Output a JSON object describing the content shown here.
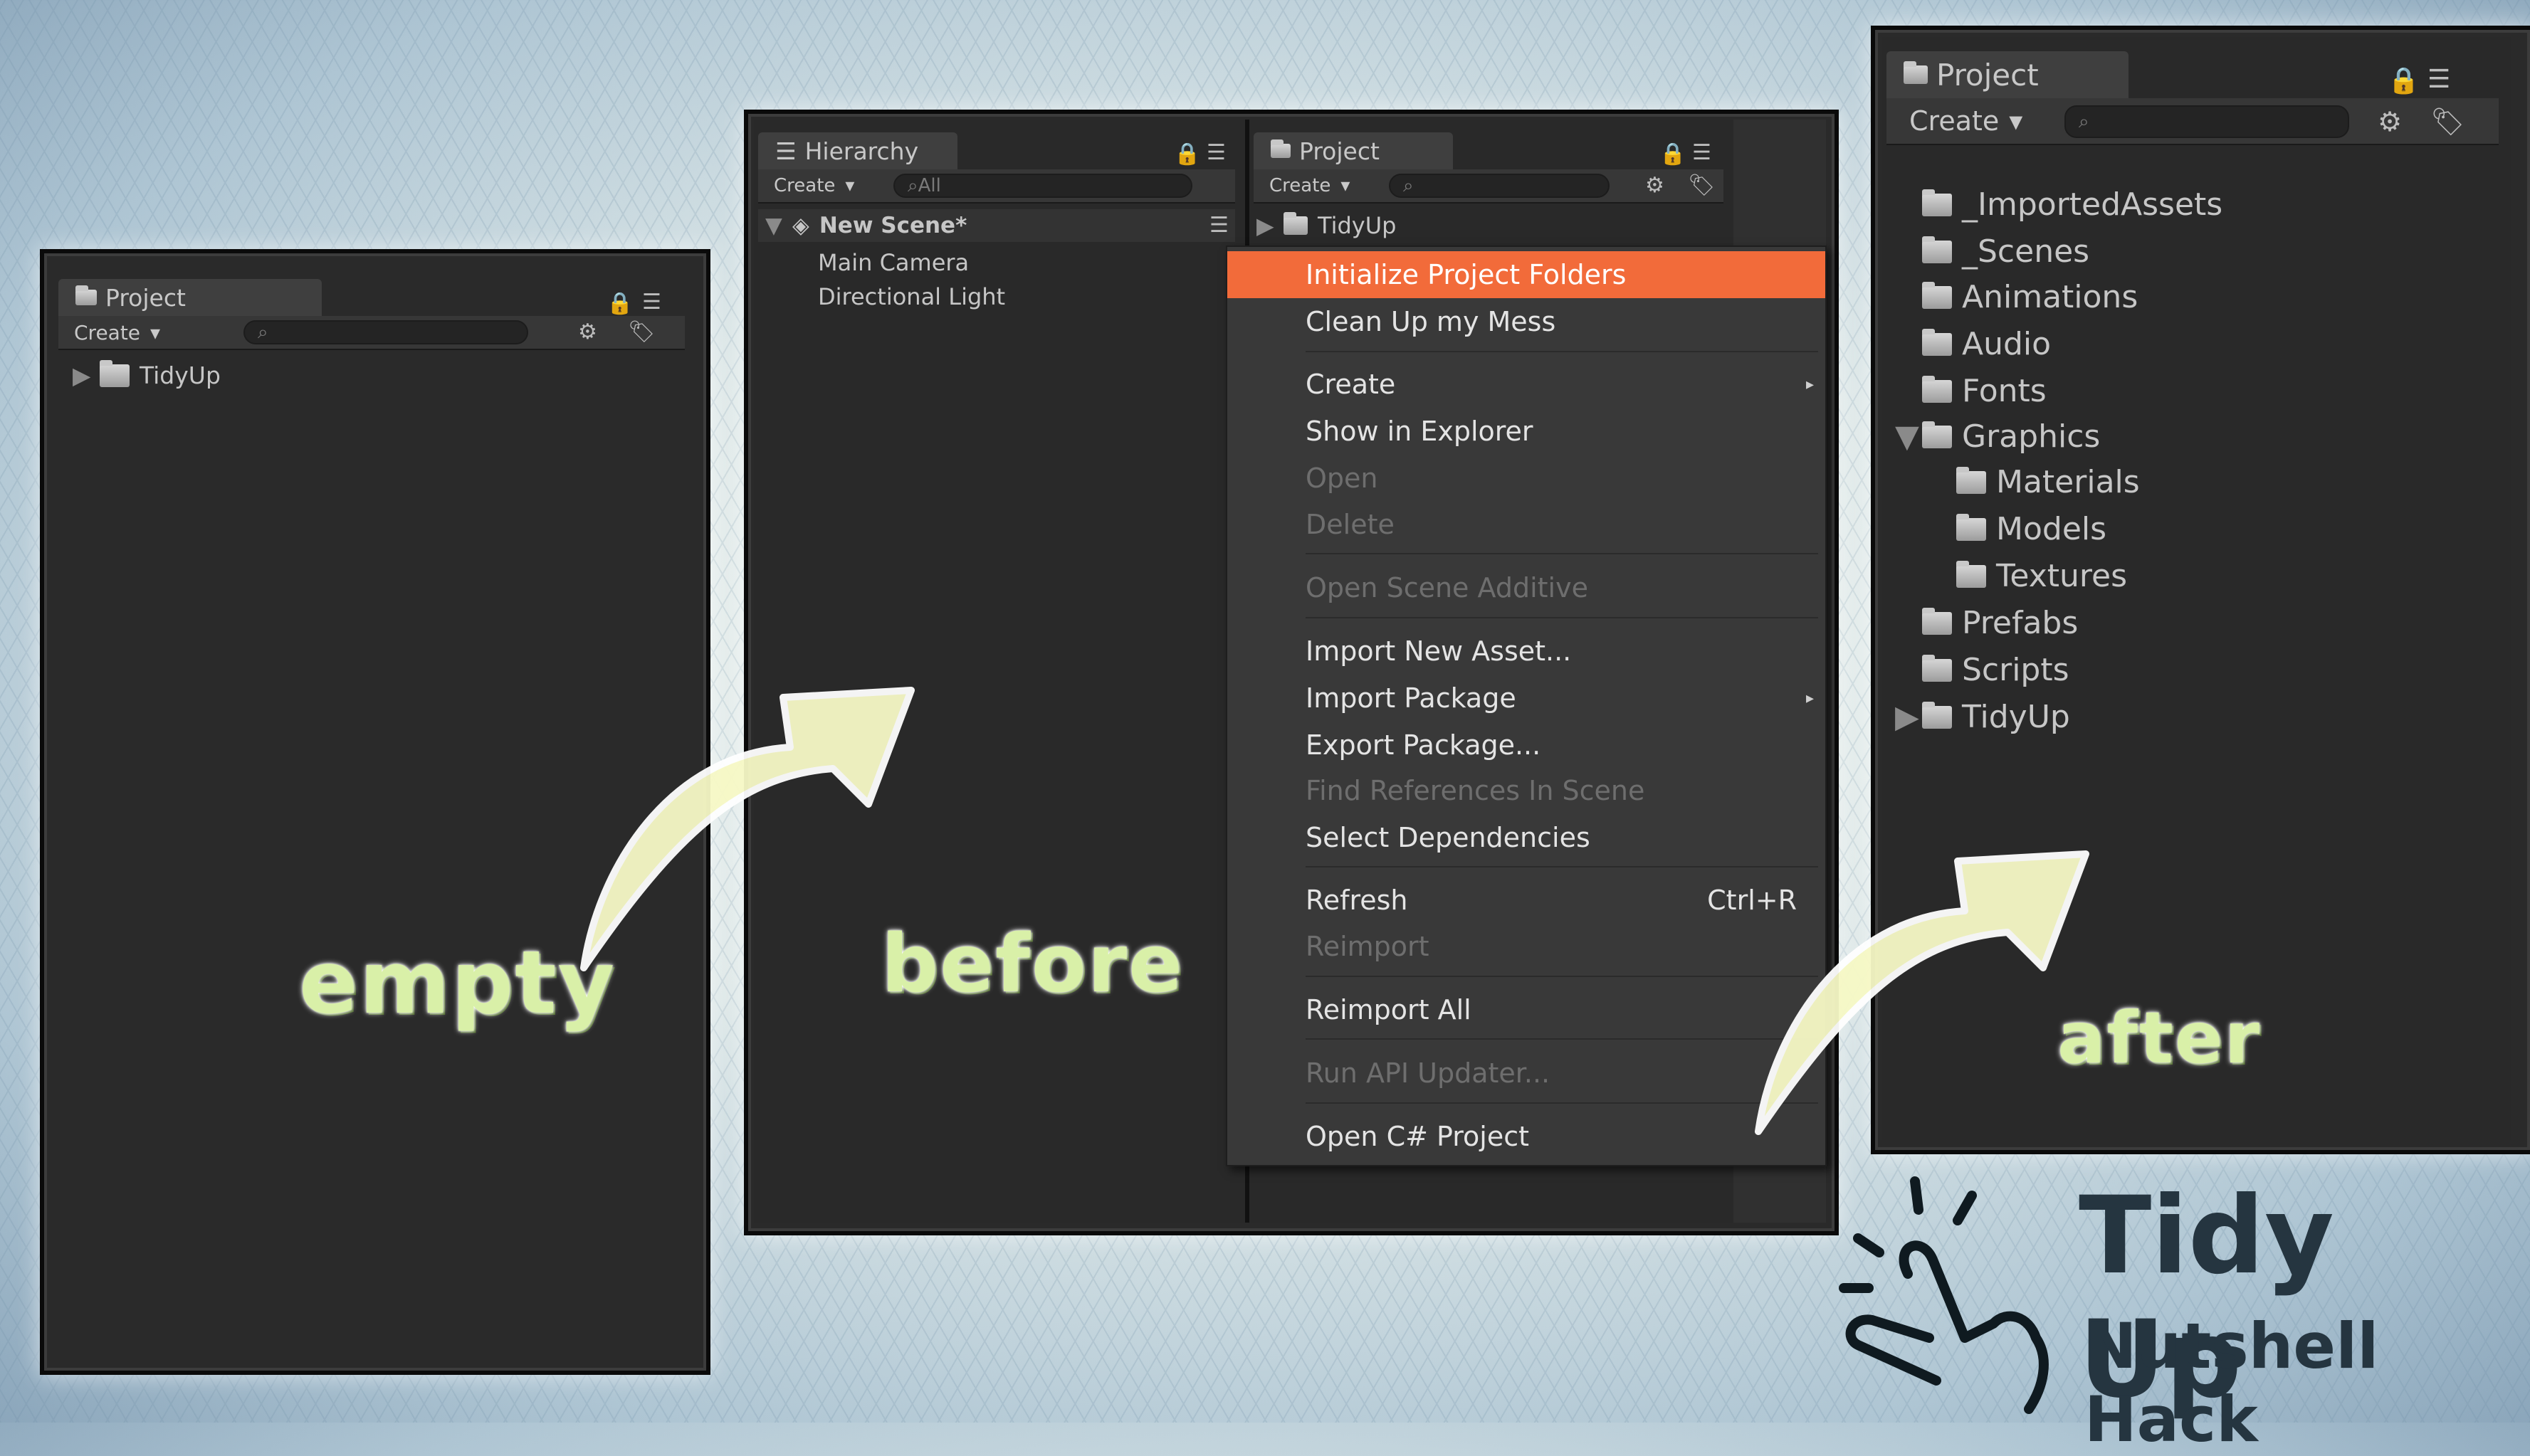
{
  "empty_panel": {
    "tab": "Project",
    "create": "Create",
    "tree": [
      {
        "label": "TidyUp"
      }
    ]
  },
  "before_panel": {
    "hierarchy": {
      "tab": "Hierarchy",
      "create": "Create",
      "search_placeholder": "All",
      "scene": "New Scene*",
      "items": [
        "Main Camera",
        "Directional Light"
      ]
    },
    "project": {
      "tab": "Project",
      "create": "Create",
      "tree": [
        {
          "label": "TidyUp"
        }
      ]
    },
    "context_menu": {
      "items": [
        {
          "label": "Initialize Project Folders",
          "state": "selected"
        },
        {
          "label": "Clean Up my Mess",
          "state": "enabled"
        },
        {
          "label": "Create",
          "state": "enabled",
          "submenu": true
        },
        {
          "label": "Show in Explorer",
          "state": "enabled"
        },
        {
          "label": "Open",
          "state": "disabled"
        },
        {
          "label": "Delete",
          "state": "disabled"
        },
        {
          "label": "Open Scene Additive",
          "state": "disabled"
        },
        {
          "label": "Import New Asset...",
          "state": "enabled"
        },
        {
          "label": "Import Package",
          "state": "enabled",
          "submenu": true
        },
        {
          "label": "Export Package...",
          "state": "enabled"
        },
        {
          "label": "Find References In Scene",
          "state": "disabled"
        },
        {
          "label": "Select Dependencies",
          "state": "enabled"
        },
        {
          "label": "Refresh",
          "state": "enabled",
          "shortcut": "Ctrl+R"
        },
        {
          "label": "Reimport",
          "state": "disabled"
        },
        {
          "label": "Reimport All",
          "state": "enabled"
        },
        {
          "label": "Run API Updater...",
          "state": "disabled"
        },
        {
          "label": "Open C# Project",
          "state": "enabled"
        }
      ]
    }
  },
  "after_panel": {
    "tab": "Project",
    "create": "Create",
    "tree": [
      {
        "label": "_ImportedAssets"
      },
      {
        "label": "_Scenes"
      },
      {
        "label": "Animations"
      },
      {
        "label": "Audio"
      },
      {
        "label": "Fonts"
      },
      {
        "label": "Graphics",
        "expanded": true
      },
      {
        "label": "Materials"
      },
      {
        "label": "Models"
      },
      {
        "label": "Textures"
      },
      {
        "label": "Prefabs"
      },
      {
        "label": "Scripts"
      },
      {
        "label": "TidyUp",
        "collapsed": true
      }
    ]
  },
  "labels": {
    "empty": "empty",
    "before": "before",
    "after": "after"
  },
  "brand": {
    "title": "Tidy Up",
    "subtitle": "Nutshell Hack"
  },
  "colors": {
    "highlight": "#f26b3a",
    "label_green": "#d9f0a8",
    "panel_bg": "#292929"
  }
}
